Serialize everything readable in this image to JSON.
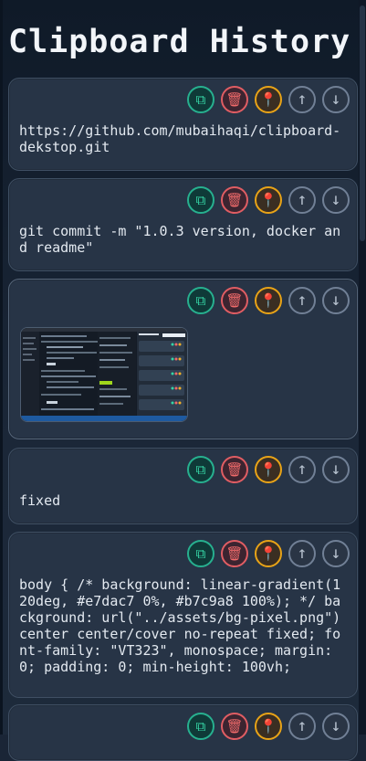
{
  "header": {
    "title": "Clipboard History"
  },
  "actions": {
    "copy_icon": "⧉",
    "delete_icon": "🗑",
    "pin_icon": "📍",
    "up_icon": "↑",
    "down_icon": "↓"
  },
  "items": [
    {
      "type": "text",
      "content": "https://github.com/mubaihaqi/clipboard-dekstop.git"
    },
    {
      "type": "text",
      "content": "git commit -m \"1.0.3 version, docker and readme\""
    },
    {
      "type": "image",
      "content": ""
    },
    {
      "type": "text",
      "content": "fixed"
    },
    {
      "type": "text",
      "content": "body { /* background: linear-gradient(120deg, #e7dac7 0%, #b7c9a8 100%); */ background: url(\"../assets/bg-pixel.png\") center center/cover no-repeat fixed; font-family: \"VT323\", monospace; margin: 0; padding: 0; min-height: 100vh;"
    },
    {
      "type": "text",
      "content": ""
    }
  ],
  "colors": {
    "copy": "#27b08f",
    "delete": "#e05d63",
    "pin": "#e8a317",
    "move": "#718096",
    "card_bg": "#273446",
    "page_bg": "#1a2536"
  }
}
